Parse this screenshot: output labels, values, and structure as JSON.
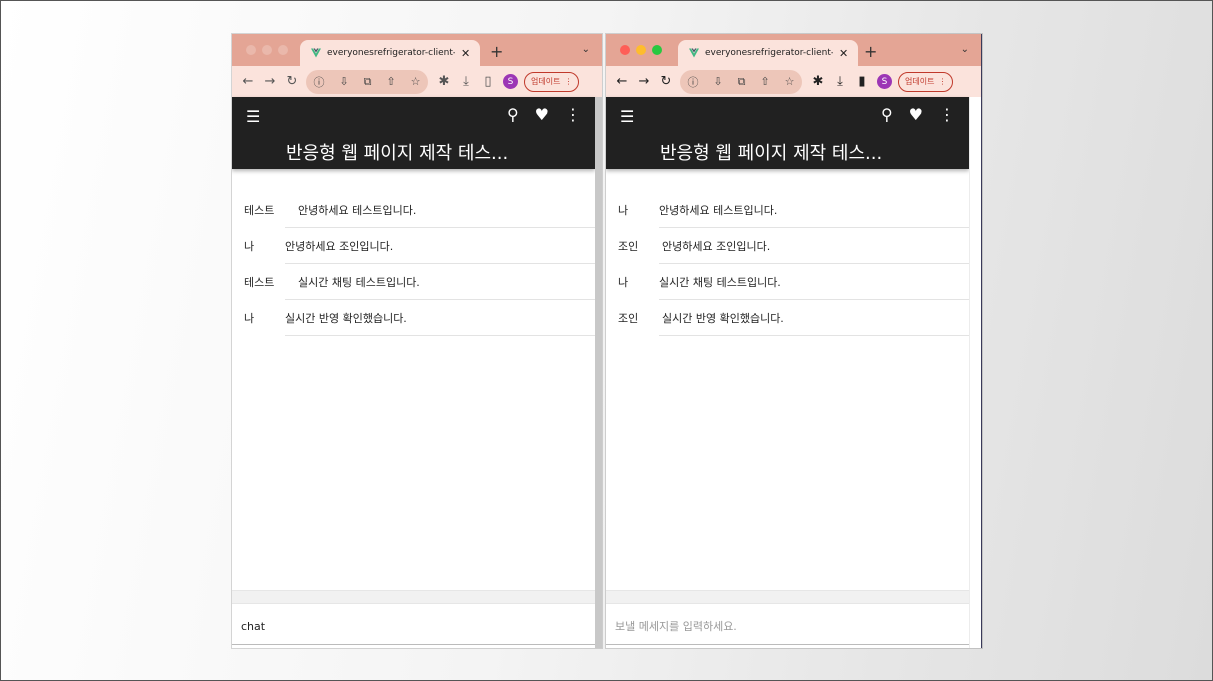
{
  "left": {
    "tab_title": "everyonesrefrigerator-client-vi",
    "update_label": "업데이트",
    "profile_initial": "S",
    "app_title": "반응형 웹 페이지 제작 테스...",
    "messages": [
      {
        "sender": "테스트",
        "text": "안녕하세요 테스트입니다."
      },
      {
        "sender": "나",
        "text": "안녕하세요 조인입니다."
      },
      {
        "sender": "테스트",
        "text": "실시간 채팅 테스트입니다."
      },
      {
        "sender": "나",
        "text": "실시간 반영 확인했습니다."
      }
    ],
    "input_value": "chat",
    "input_placeholder": "보낼 메세지를 입력하세요."
  },
  "right": {
    "tab_title": "everyonesrefrigerator-client-vi",
    "update_label": "업데이트",
    "profile_initial": "S",
    "app_title": "반응형 웹 페이지 제작 테스...",
    "messages": [
      {
        "sender": "나",
        "text": "안녕하세요 테스트입니다."
      },
      {
        "sender": "조인",
        "text": "안녕하세요 조인입니다."
      },
      {
        "sender": "나",
        "text": "실시간 채팅 테스트입니다."
      },
      {
        "sender": "조인",
        "text": "실시간 반영 확인했습니다."
      }
    ],
    "input_value": "",
    "input_placeholder": "보낼 메세지를 입력하세요."
  },
  "icons": {
    "menu": "menu-icon",
    "search": "search-icon",
    "favorite": "heart-icon",
    "more": "more-vert-icon"
  },
  "colors": {
    "app_bar": "#212121",
    "tab_strip": "#e4a595",
    "toolbar": "#fbe3dc",
    "update_button": "#c0392b",
    "profile": "#9c36b5"
  }
}
